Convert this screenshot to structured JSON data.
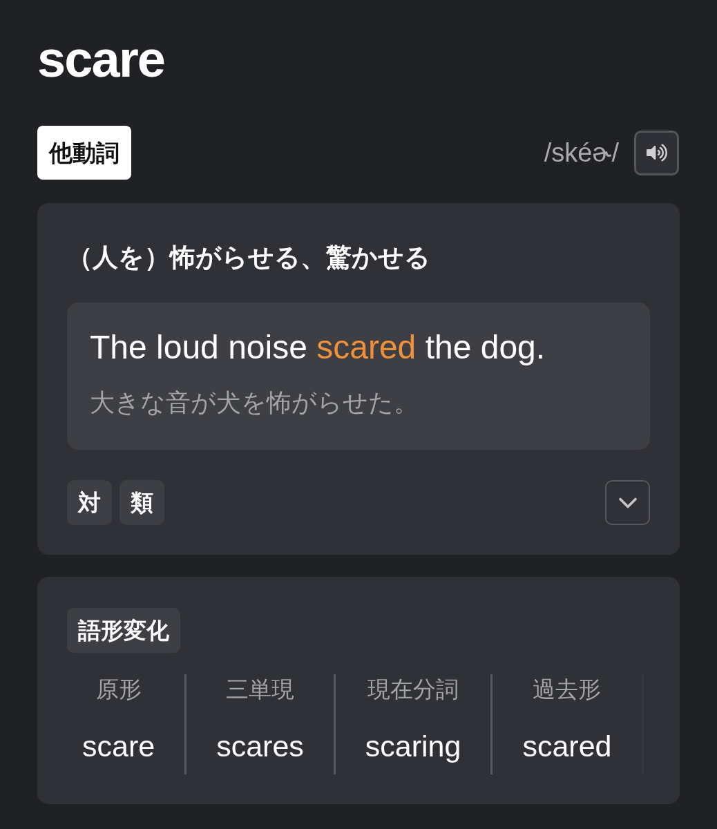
{
  "title": "scare",
  "header": {
    "part_of_speech": "他動詞",
    "pronunciation": "/skéɚ/"
  },
  "sense": {
    "meaning": "（人を）怖がらせる、驚かせる",
    "example": {
      "parts": [
        {
          "text": "The loud noise ",
          "highlight": false
        },
        {
          "text": "scared",
          "highlight": true
        },
        {
          "text": " the dog.",
          "highlight": false
        }
      ],
      "translation": "大きな音が犬を怖がらせた。"
    },
    "tags": [
      "対",
      "類"
    ],
    "expanded": false
  },
  "inflections": {
    "label": "語形変化",
    "columns": [
      {
        "header": "原形",
        "value": "scare"
      },
      {
        "header": "三単現",
        "value": "scares"
      },
      {
        "header": "現在分詞",
        "value": "scaring"
      },
      {
        "header": "過去形",
        "value": "scared"
      }
    ]
  }
}
